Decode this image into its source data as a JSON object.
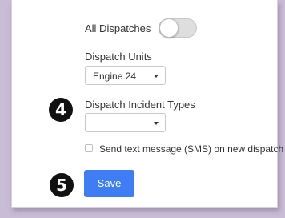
{
  "form": {
    "all_dispatches_label": "All Dispatches",
    "all_dispatches_on": false,
    "dispatch_units_label": "Dispatch Units",
    "dispatch_units_value": "Engine 24",
    "incident_types_label": "Dispatch Incident Types",
    "incident_types_value": "",
    "sms_label": "Send text message (SMS) on new dispatch",
    "sms_checked": false,
    "save_label": "Save"
  },
  "annotations": {
    "step4": "4",
    "step5": "5"
  },
  "colors": {
    "accent": "#3f7df5",
    "badge": "#111111",
    "frame": "#c9bcd6"
  }
}
